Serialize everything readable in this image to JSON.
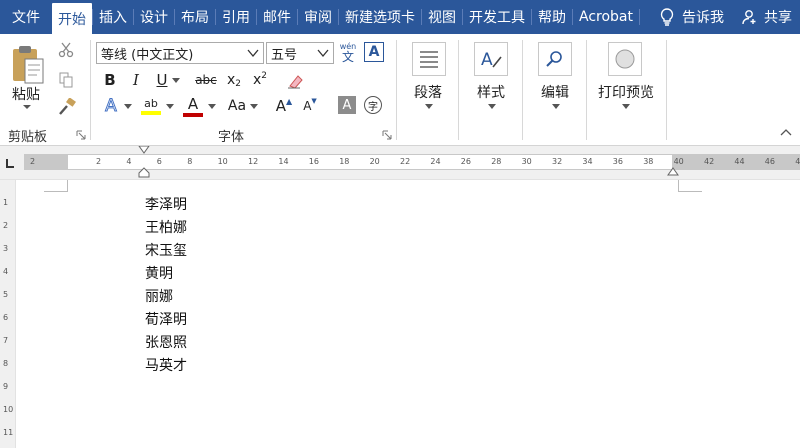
{
  "tabs": [
    "文件",
    "开始",
    "插入",
    "设计",
    "布局",
    "引用",
    "邮件",
    "审阅",
    "新建选项卡",
    "视图",
    "开发工具",
    "帮助",
    "Acrobat"
  ],
  "active_tab": "开始",
  "tell_me": "告诉我",
  "share": "共享",
  "clipboard": {
    "paste": "粘贴",
    "group_label": "剪贴板"
  },
  "font": {
    "name": "等线 (中文正文)",
    "size": "五号",
    "phonetic_top": "wén",
    "phonetic_bottom": "文",
    "bold": "B",
    "italic": "I",
    "underline": "U",
    "strike": "abc",
    "subscript_base": "x",
    "subscript_idx": "2",
    "superscript_base": "x",
    "superscript_idx": "2",
    "text_effect": "A",
    "highlight": "ab",
    "font_color": "A",
    "change_case": "Aa",
    "grow": "A",
    "shrink": "A",
    "shading": "A",
    "enclose": "字",
    "group_label": "字体"
  },
  "paragraph": {
    "label": "段落"
  },
  "styles": {
    "label": "样式"
  },
  "editing": {
    "label": "编辑"
  },
  "print_preview": {
    "label": "打印预览"
  },
  "ruler_ticks": [
    "2",
    "2",
    "4",
    "6",
    "8",
    "10",
    "12",
    "14",
    "16",
    "18",
    "20",
    "22",
    "24",
    "26",
    "28",
    "30",
    "32",
    "34",
    "36",
    "38",
    "40",
    "42",
    "44",
    "46",
    "48"
  ],
  "vruler_ticks": [
    "1",
    "2",
    "3",
    "4",
    "5",
    "6",
    "7",
    "8",
    "9",
    "10",
    "11"
  ],
  "document_lines": [
    "李泽明",
    "王柏娜",
    "宋玉玺",
    "黄明",
    "丽娜",
    "荀泽明",
    "张恩照",
    "马英才"
  ],
  "colors": {
    "accent": "#2b579a",
    "highlight": "#ffff00",
    "font_color": "#c00000"
  }
}
